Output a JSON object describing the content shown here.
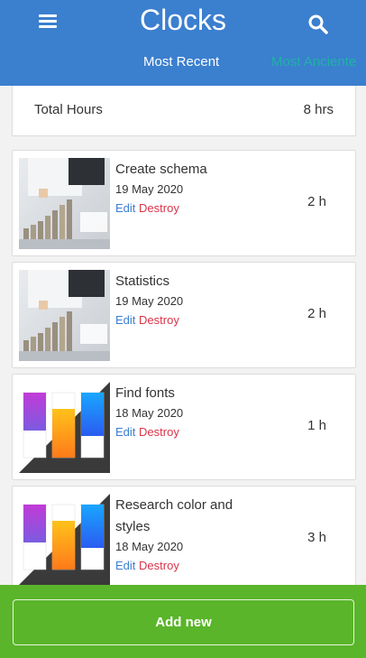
{
  "header": {
    "title": "Clocks",
    "tabs": [
      "Most Recent",
      "Most Anciente"
    ]
  },
  "summary": {
    "label": "Total Hours",
    "value": "8 hrs"
  },
  "clocks": [
    {
      "name": "Create schema",
      "date": "19 May 2020",
      "edit": "Edit",
      "destroy": "Destroy",
      "hours": "2 h",
      "image": "business-coins"
    },
    {
      "name": "Statistics",
      "date": "19 May 2020",
      "edit": "Edit",
      "destroy": "Destroy",
      "hours": "2 h",
      "image": "business-coins"
    },
    {
      "name": "Find fonts",
      "date": "18 May 2020",
      "edit": "Edit",
      "destroy": "Destroy",
      "hours": "1 h",
      "image": "color-banners"
    },
    {
      "name": "Research color and styles",
      "date": "18 May 2020",
      "edit": "Edit",
      "destroy": "Destroy",
      "hours": "3 h",
      "image": "color-banners"
    }
  ],
  "footer": {
    "add_label": "Add new"
  },
  "colors": {
    "header": "#3b7fcf",
    "footer": "#5ab52a",
    "edit": "#3b7fcf",
    "destroy": "#d9334a",
    "active_tab": "#ffffff",
    "inactive_tab": "#20b2a6"
  }
}
